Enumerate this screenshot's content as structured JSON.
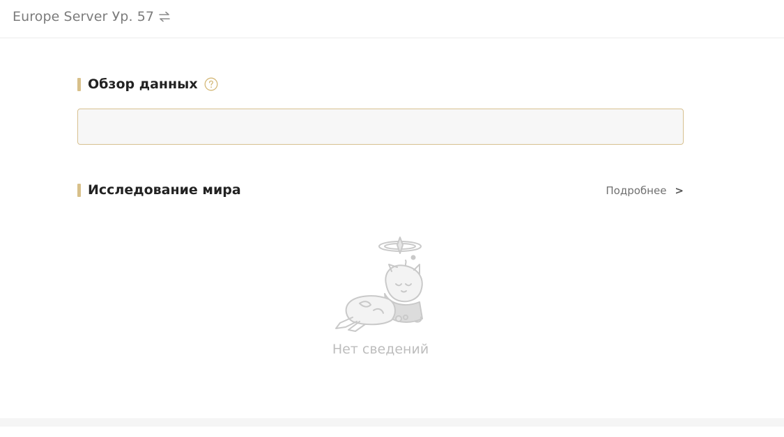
{
  "header": {
    "server_label": "Europe Server Ур. 57",
    "swap_icon": "swap-arrows-icon"
  },
  "overview": {
    "title": "Обзор данных",
    "help_icon": "question-circle-icon"
  },
  "exploration": {
    "title": "Исследование мира",
    "more_label": "Подробнее",
    "more_chevron": ">",
    "empty_text": "Нет сведений",
    "empty_illustration": "sleeping-character-illustration"
  },
  "colors": {
    "accent": "#d8c08a",
    "title_text": "#222222",
    "muted_text": "#7b7b7b",
    "empty_text": "#bdbdbd"
  }
}
